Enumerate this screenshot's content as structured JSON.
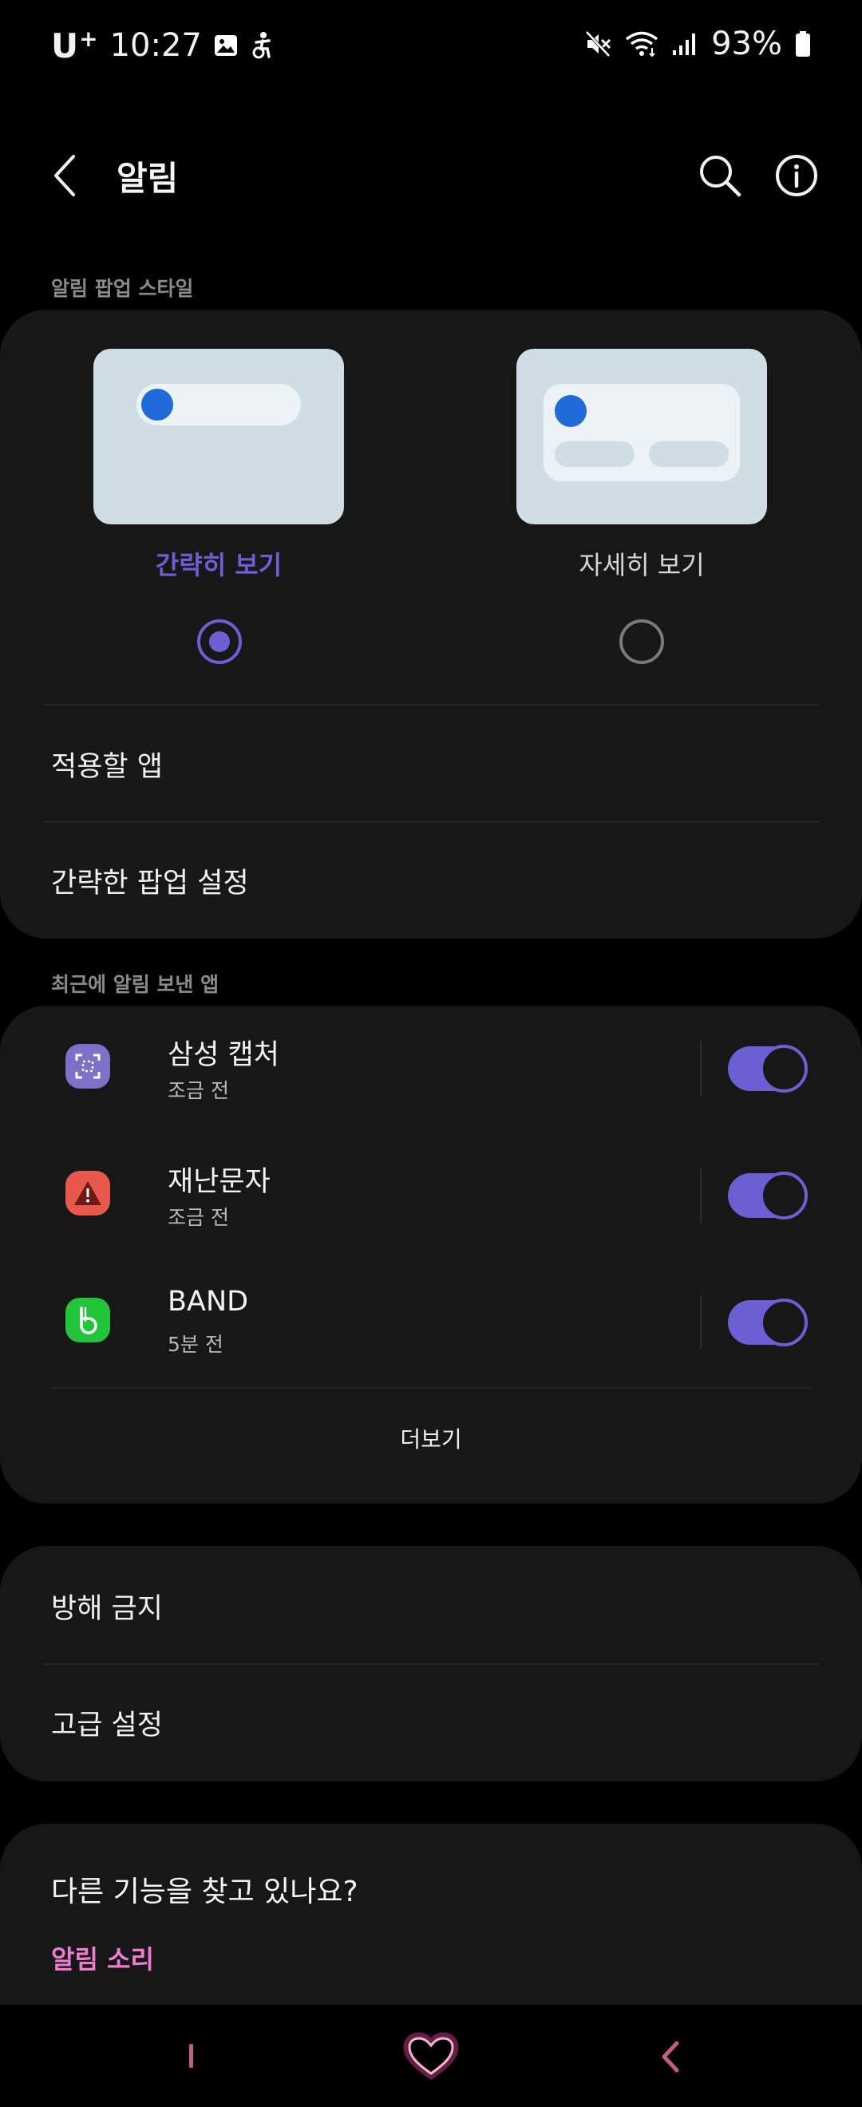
{
  "status_bar": {
    "carrier": "U",
    "carrier_sup": "+",
    "time": "10:27",
    "battery": "93%"
  },
  "header": {
    "title": "알림"
  },
  "popup_style": {
    "section_label": "알림 팝업 스타일",
    "options": [
      {
        "label": "간략히 보기",
        "selected": true
      },
      {
        "label": "자세히 보기",
        "selected": false
      }
    ],
    "apps_to_apply": "적용할 앱",
    "brief_popup_settings": "간략한 팝업 설정"
  },
  "recent_apps": {
    "section_label": "최근에 알림 보낸 앱",
    "items": [
      {
        "name": "삼성 캡처",
        "time": "조금 전",
        "enabled": true,
        "icon": "samsung-capture-icon",
        "color": "#7b71c9"
      },
      {
        "name": "재난문자",
        "time": "조금 전",
        "enabled": true,
        "icon": "warning-icon",
        "color": "#e8584c"
      },
      {
        "name": "BAND",
        "time": "5분 전",
        "enabled": true,
        "icon": "band-icon",
        "color": "#22c43a"
      }
    ],
    "more_label": "더보기"
  },
  "other_settings": {
    "do_not_disturb": "방해 금지",
    "advanced": "고급 설정"
  },
  "looking_for": {
    "title": "다른 기능을 찾고 있나요?",
    "link": "알림 소리"
  },
  "colors": {
    "accent": "#6b5fd3",
    "link": "#f07ccf",
    "card_bg": "#171717",
    "page_bg": "#000000"
  }
}
